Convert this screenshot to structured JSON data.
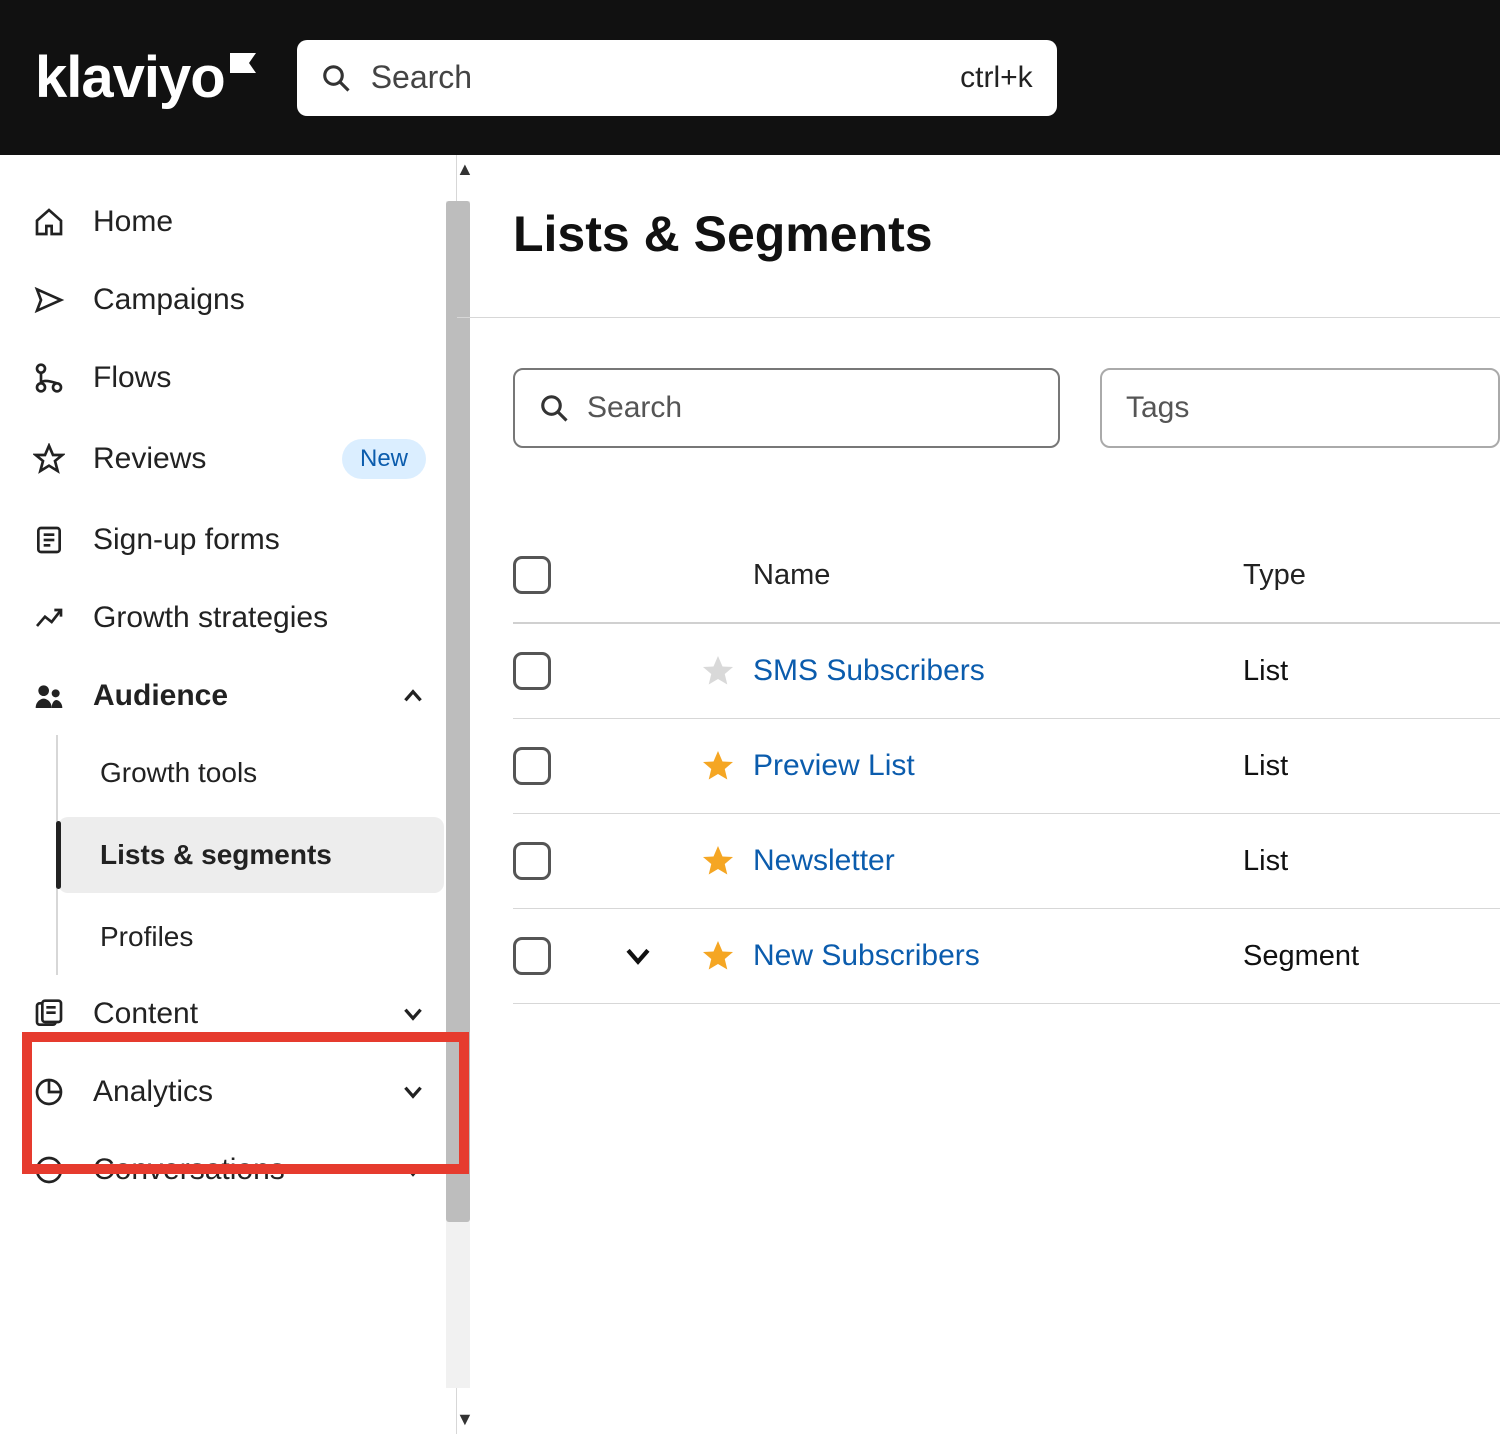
{
  "topbar": {
    "logo_text": "klaviyo",
    "search_placeholder": "Search",
    "search_shortcut": "ctrl+k"
  },
  "sidebar": {
    "items": [
      {
        "icon": "home-icon",
        "label": "Home"
      },
      {
        "icon": "campaigns-icon",
        "label": "Campaigns"
      },
      {
        "icon": "flows-icon",
        "label": "Flows"
      },
      {
        "icon": "star-icon",
        "label": "Reviews",
        "badge": "New"
      },
      {
        "icon": "form-icon",
        "label": "Sign-up forms"
      },
      {
        "icon": "growth-icon",
        "label": "Growth strategies"
      },
      {
        "icon": "audience-icon",
        "label": "Audience",
        "expanded": true
      },
      {
        "icon": "content-icon",
        "label": "Content",
        "expanded": false
      },
      {
        "icon": "analytics-icon",
        "label": "Analytics",
        "expanded": false
      },
      {
        "icon": "conversations-icon",
        "label": "Conversations",
        "expanded": false
      }
    ],
    "audience_sub": [
      {
        "label": "Growth tools"
      },
      {
        "label": "Lists & segments",
        "active": true
      },
      {
        "label": "Profiles"
      }
    ]
  },
  "main": {
    "title": "Lists & Segments",
    "search_placeholder": "Search",
    "tags_placeholder": "Tags",
    "columns": {
      "name": "Name",
      "type": "Type"
    },
    "rows": [
      {
        "starred": false,
        "expandable": false,
        "name": "SMS Subscribers",
        "type": "List"
      },
      {
        "starred": true,
        "expandable": false,
        "name": "Preview List",
        "type": "List"
      },
      {
        "starred": true,
        "expandable": false,
        "name": "Newsletter",
        "type": "List"
      },
      {
        "starred": true,
        "expandable": true,
        "name": "New Subscribers",
        "type": "Segment"
      }
    ]
  },
  "colors": {
    "link": "#0b5cad",
    "highlight": "#e63b2e",
    "star_on": "#f5a623",
    "star_off": "#d9d9d9"
  }
}
